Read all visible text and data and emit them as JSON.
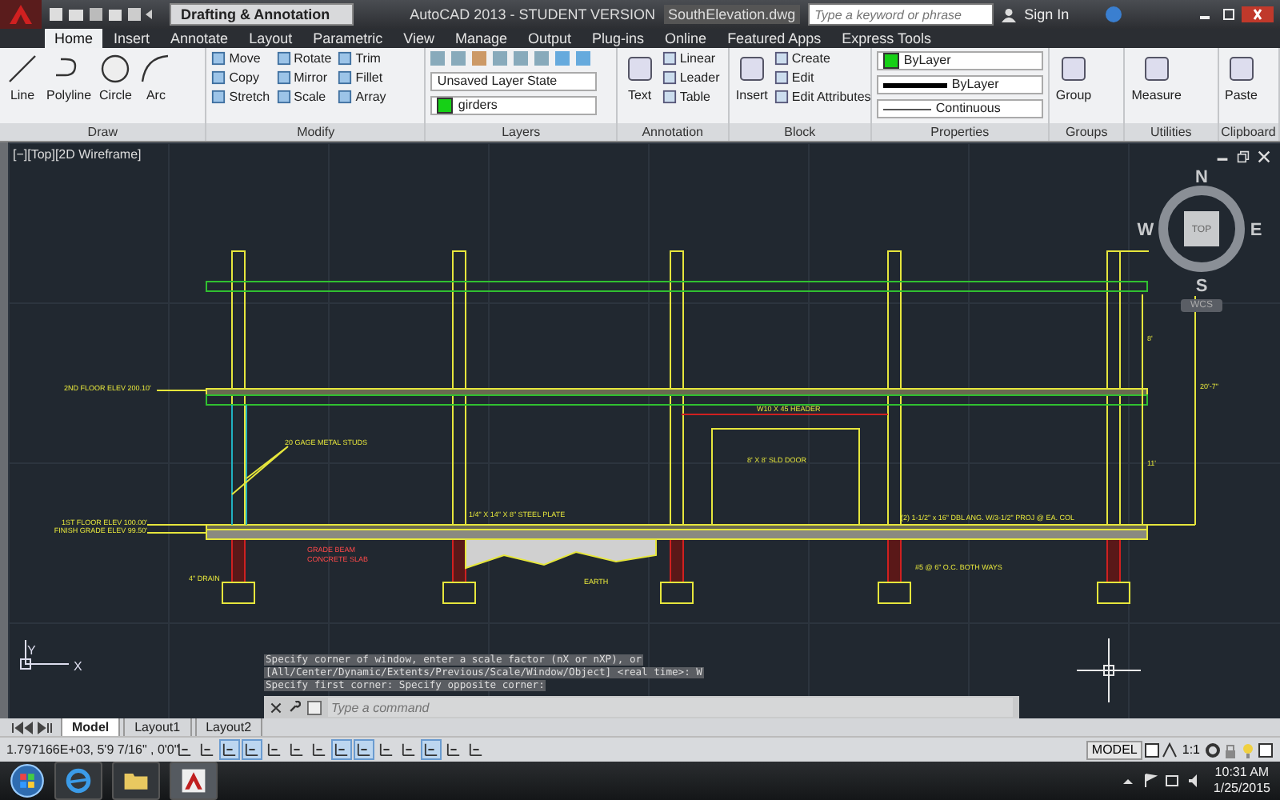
{
  "title_bar": {
    "workspace": "Drafting & Annotation",
    "app_title": "AutoCAD 2013 - STUDENT VERSION",
    "file_name": "SouthElevation.dwg",
    "search": {
      "placeholder": "Type a keyword or phrase"
    },
    "sign_in": "Sign In"
  },
  "ribbon_tabs": [
    {
      "label": "Home",
      "selected": true
    },
    {
      "label": "Insert",
      "selected": false
    },
    {
      "label": "Annotate",
      "selected": false
    },
    {
      "label": "Layout",
      "selected": false
    },
    {
      "label": "Parametric",
      "selected": false
    },
    {
      "label": "View",
      "selected": false
    },
    {
      "label": "Manage",
      "selected": false
    },
    {
      "label": "Output",
      "selected": false
    },
    {
      "label": "Plug-ins",
      "selected": false
    },
    {
      "label": "Online",
      "selected": false
    },
    {
      "label": "Featured Apps",
      "selected": false
    },
    {
      "label": "Express Tools",
      "selected": false
    }
  ],
  "ribbon_panels": [
    {
      "kind": "draw",
      "title": "Draw",
      "tools": [
        "Line",
        "Polyline",
        "Circle",
        "Arc"
      ]
    },
    {
      "kind": "modify",
      "title": "Modify",
      "tools": [
        "Move",
        "Rotate",
        "Trim",
        "Copy",
        "Mirror",
        "Fillet",
        "Stretch",
        "Scale",
        "Array"
      ]
    },
    {
      "kind": "layers",
      "title": "Layers",
      "layer_state": "Unsaved Layer State",
      "current_layer": "girders"
    },
    {
      "kind": "annotation",
      "title": "Annotation",
      "large_tool": "Text",
      "tools": [
        "Linear",
        "Leader",
        "Table"
      ]
    },
    {
      "kind": "block",
      "title": "Block",
      "large_tool": "Insert",
      "tools": [
        "Create",
        "Edit",
        "Edit Attributes"
      ]
    },
    {
      "kind": "properties",
      "title": "Properties",
      "color_setting": "ByLayer",
      "lineweight": "ByLayer",
      "linetype": "Continuous"
    },
    {
      "kind": "groups",
      "title": "Groups",
      "large_tool": "Group"
    },
    {
      "kind": "utilities",
      "title": "Utilities",
      "large_tool": "Measure"
    },
    {
      "kind": "clipboard",
      "title": "Clipboard",
      "large_tool": "Paste"
    }
  ],
  "viewport": {
    "label": "[−][Top][2D Wireframe]",
    "compass": {
      "north": "N",
      "south": "S",
      "east": "E",
      "west": "W",
      "face": "TOP"
    },
    "ucs_button": "WCS",
    "axis_labels": {
      "x": "X",
      "y": "Y"
    },
    "annotations": [
      {
        "text": "2ND FLOOR ELEV 200.10'",
        "kind": "note"
      },
      {
        "text": "20 GAGE METAL STUDS",
        "kind": "note"
      },
      {
        "text": "1ST FLOOR ELEV 100.00'",
        "kind": "note"
      },
      {
        "text": "FINISH GRADE ELEV 99.50'",
        "kind": "note"
      },
      {
        "text": "GRADE BEAM",
        "kind": "warning"
      },
      {
        "text": "CONCRETE SLAB",
        "kind": "warning"
      },
      {
        "text": "4\" DRAIN",
        "kind": "note"
      },
      {
        "text": "1/4\" X 14\" X 8\" STEEL PLATE",
        "kind": "note"
      },
      {
        "text": "EARTH",
        "kind": "note"
      },
      {
        "text": "W10 X 45 HEADER",
        "kind": "note"
      },
      {
        "text": "8' X 8' SLD DOOR",
        "kind": "note"
      },
      {
        "text": "(2) 1-1/2\" x 16\" DBL ANG. W/3-1/2\" PROJ @ EA. COL",
        "kind": "note"
      },
      {
        "text": "#5 @ 6\" O.C. BOTH WAYS",
        "kind": "note"
      },
      {
        "text": "8'",
        "kind": "note"
      },
      {
        "text": "11'",
        "kind": "note"
      },
      {
        "text": "20'-7\"",
        "kind": "note"
      }
    ]
  },
  "command_line": {
    "history": [
      "Specify corner of window, enter a scale factor (nX or nXP), or",
      "[All/Center/Dynamic/Extents/Previous/Scale/Window/Object] <real time>: W",
      "Specify first corner: Specify opposite corner:"
    ],
    "placeholder": "Type a command"
  },
  "layout_tabs": [
    {
      "label": "Model",
      "selected": true
    },
    {
      "label": "Layout1",
      "selected": false
    },
    {
      "label": "Layout2",
      "selected": false
    }
  ],
  "status_bar": {
    "coordinates": "1.797166E+03, 5'9 7/16\" , 0'0\"",
    "toggles": [
      {
        "on": false
      },
      {
        "on": false
      },
      {
        "on": true
      },
      {
        "on": true
      },
      {
        "on": false
      },
      {
        "on": false
      },
      {
        "on": false
      },
      {
        "on": true
      },
      {
        "on": true
      },
      {
        "on": false
      },
      {
        "on": false
      },
      {
        "on": true
      },
      {
        "on": false
      },
      {
        "on": false
      }
    ],
    "model": "MODEL",
    "scale": "1:1"
  },
  "taskbar": {
    "time": "10:31 AM",
    "date": "1/25/2015"
  }
}
